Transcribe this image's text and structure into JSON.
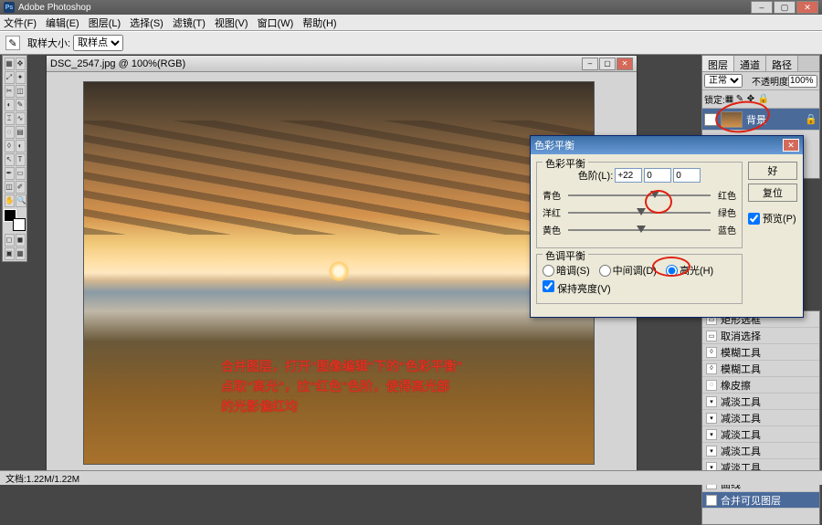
{
  "app": {
    "title": "Adobe Photoshop"
  },
  "menu": [
    "文件(F)",
    "编辑(E)",
    "图层(L)",
    "选择(S)",
    "滤镜(T)",
    "视图(V)",
    "窗口(W)",
    "帮助(H)"
  ],
  "options": {
    "label": "取样大小:",
    "value": "取样点"
  },
  "doc": {
    "title": "DSC_2547.jpg @ 100%(RGB)"
  },
  "annotation": {
    "line1": "合并图层，打开\"图像编辑\"下的\"色彩平衡\"",
    "line2": "点取\"高光\"，拉\"红色\"色阶，使得高光部",
    "line3": "的光影偏红均"
  },
  "layers_panel": {
    "tabs": [
      "图层",
      "通道",
      "路径"
    ],
    "mode": "正常",
    "opacity_label": "不透明度",
    "opacity_value": "100%",
    "lock_label": "锁定:",
    "layer_name": "背景"
  },
  "history": {
    "items": [
      {
        "icon": "▭",
        "label": "矩形选框"
      },
      {
        "icon": "▭",
        "label": "取消选择"
      },
      {
        "icon": "◊",
        "label": "模糊工具"
      },
      {
        "icon": "◊",
        "label": "模糊工具"
      },
      {
        "icon": "◌",
        "label": "橡皮擦"
      },
      {
        "icon": "▾",
        "label": "减淡工具"
      },
      {
        "icon": "▾",
        "label": "减淡工具"
      },
      {
        "icon": "▾",
        "label": "减淡工具"
      },
      {
        "icon": "▾",
        "label": "减淡工具"
      },
      {
        "icon": "▾",
        "label": "减淡工具"
      },
      {
        "icon": "~",
        "label": "曲线"
      }
    ],
    "footer": "合并可见图层"
  },
  "dialog": {
    "title": "色彩平衡",
    "group1": "色彩平衡",
    "levels_label": "色阶(L):",
    "lv1": "+22",
    "lv2": "0",
    "lv3": "0",
    "cyan": "青色",
    "red": "红色",
    "magenta": "洋红",
    "green": "绿色",
    "yellow": "黄色",
    "blue": "蓝色",
    "group2": "色调平衡",
    "shadows": "暗调(S)",
    "midtones": "中间调(D)",
    "highlights": "高光(H)",
    "preserve": "保持亮度(V)",
    "ok": "好",
    "cancel": "复位",
    "preview": "预览(P)"
  },
  "status": {
    "text": "文档:1.22M/1.22M"
  },
  "tools": [
    "▦",
    "⬚",
    "⤢",
    "✂",
    "∿",
    "✎",
    "⌶",
    "◧",
    "◐",
    "T",
    "◫",
    "▭",
    "✥",
    "Q"
  ]
}
